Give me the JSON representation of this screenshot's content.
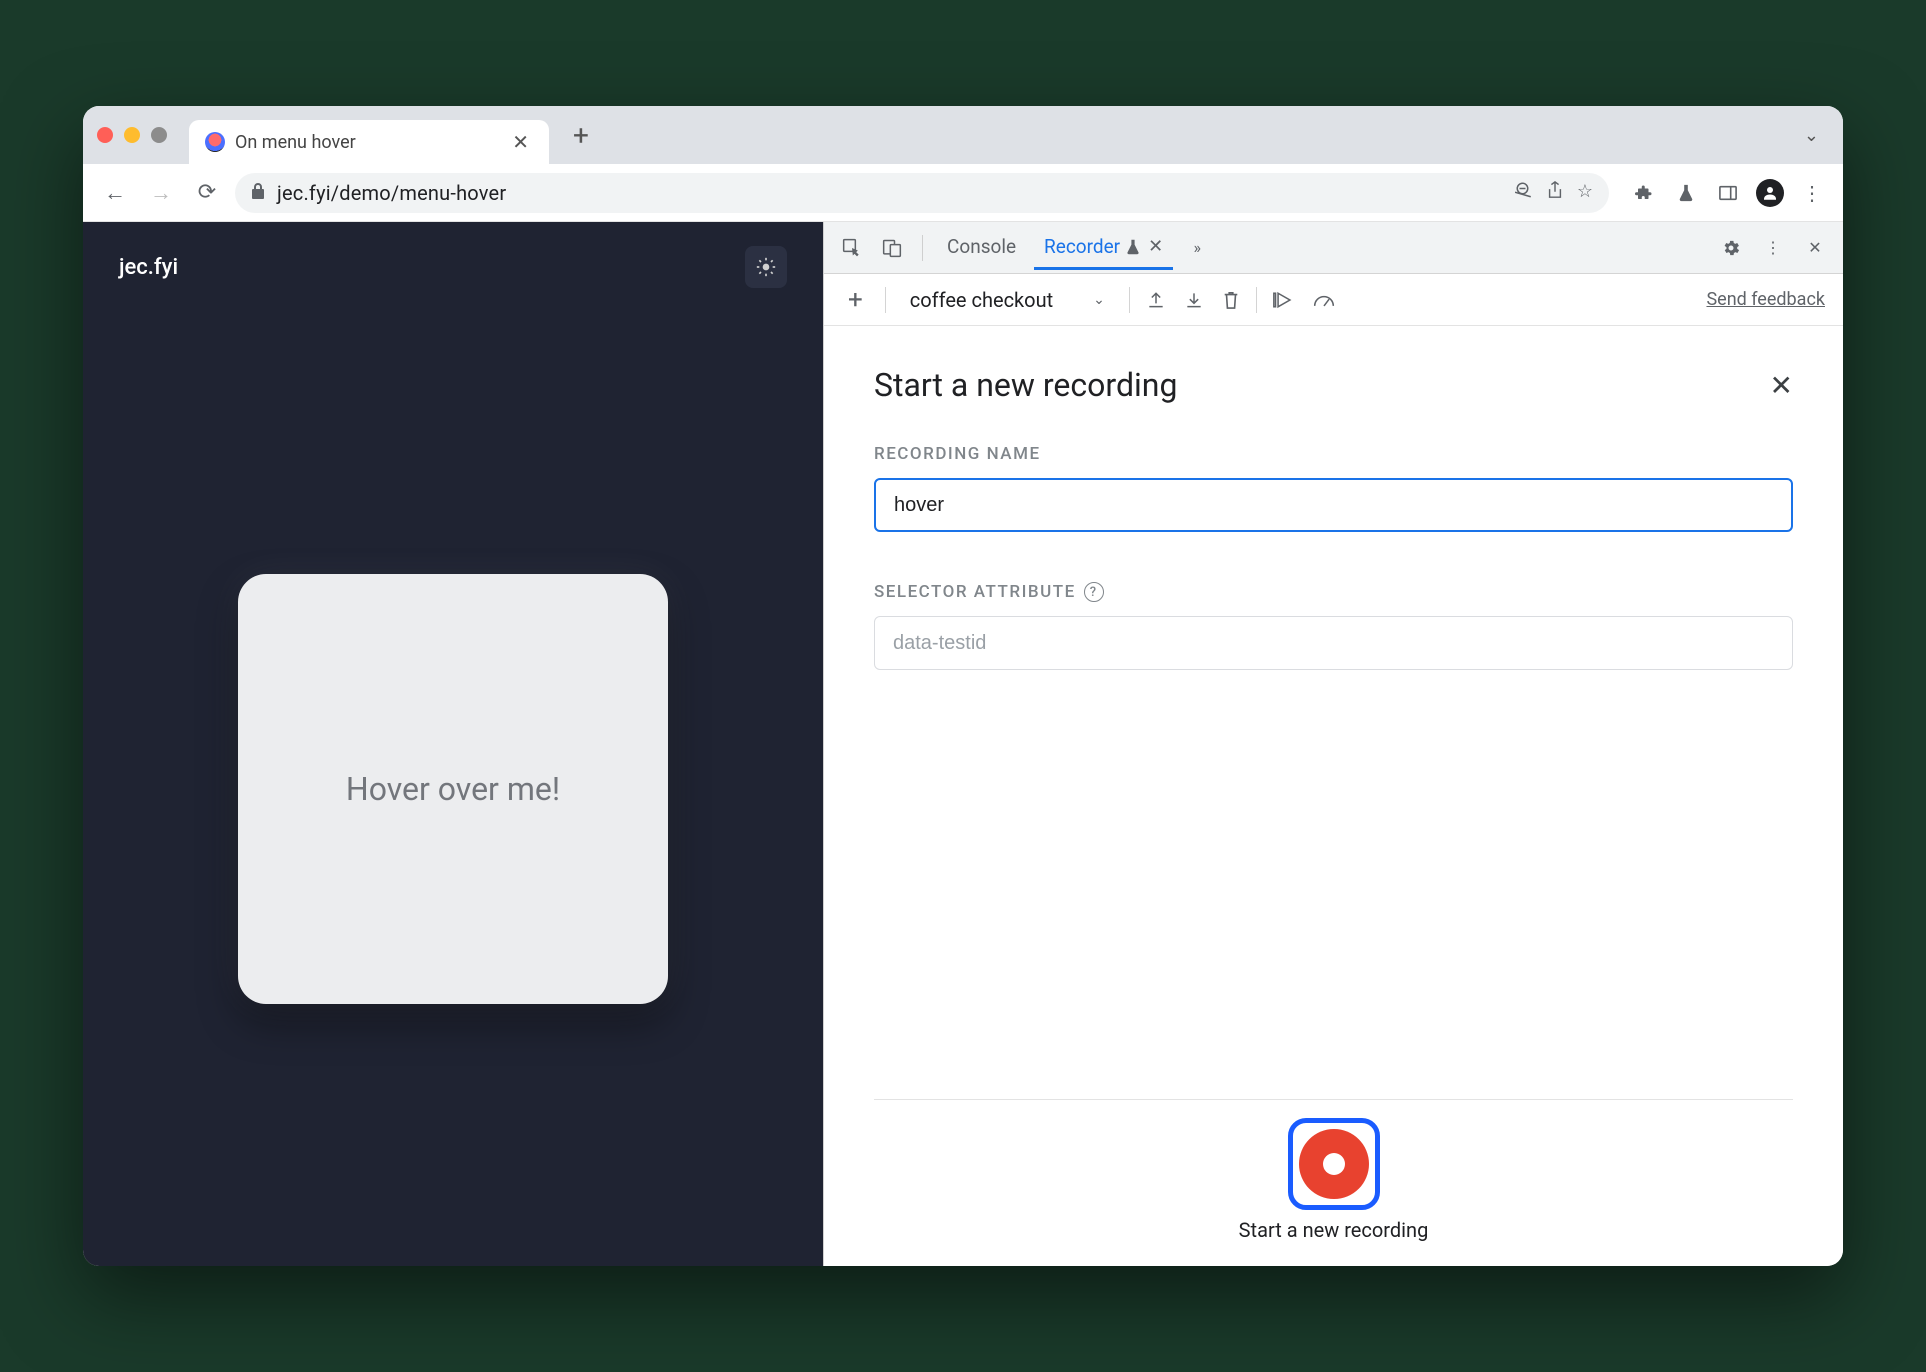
{
  "tab": {
    "title": "On menu hover"
  },
  "address": {
    "url": "jec.fyi/demo/menu-hover"
  },
  "page": {
    "site_name": "jec.fyi",
    "card_text": "Hover over me!"
  },
  "devtools": {
    "tabs": {
      "console": "Console",
      "recorder": "Recorder"
    }
  },
  "recorder": {
    "dropdown_value": "coffee checkout",
    "feedback": "Send feedback",
    "title": "Start a new recording",
    "labels": {
      "recording_name": "RECORDING NAME",
      "selector_attribute": "SELECTOR ATTRIBUTE"
    },
    "recording_name_value": "hover",
    "selector_placeholder": "data-testid",
    "start_button_label": "Start a new recording"
  }
}
